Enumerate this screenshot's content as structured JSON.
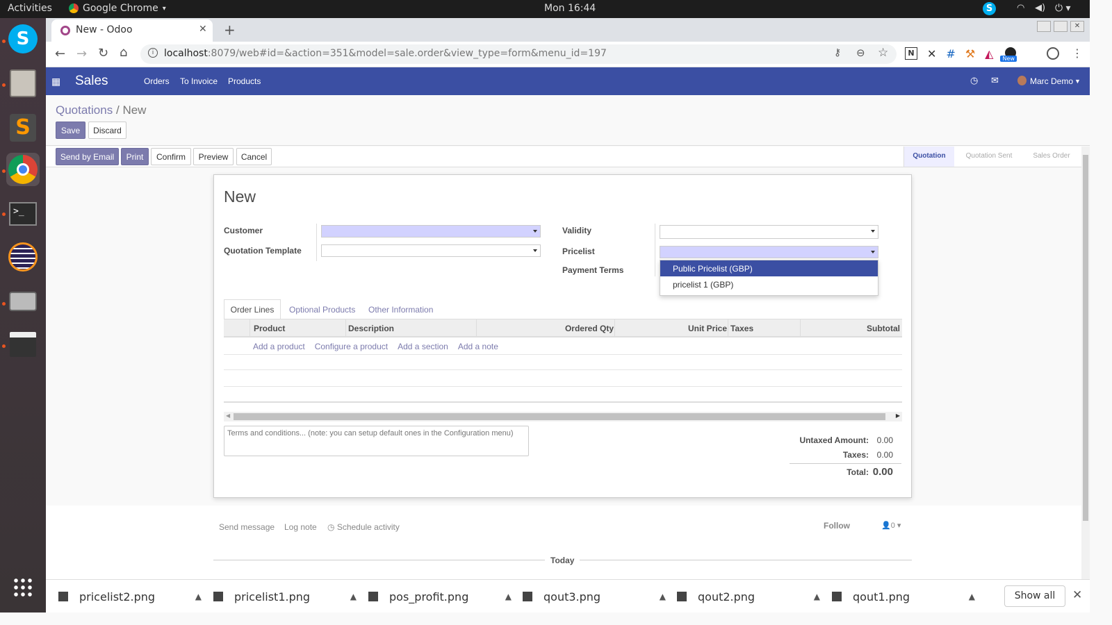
{
  "os": {
    "activities": "Activities",
    "app_menu": "Google Chrome",
    "clock": "Mon 16:44"
  },
  "browser": {
    "tab_title": "New - Odoo",
    "url_host": "localhost",
    "url_rest": ":8079/web#id=&action=351&model=sale.order&view_type=form&menu_id=197",
    "new_badge": "New"
  },
  "odoo_nav": {
    "app": "Sales",
    "menus": [
      "Orders",
      "To Invoice",
      "Products"
    ],
    "user": "Marc Demo"
  },
  "breadcrumb": {
    "parent": "Quotations",
    "sep": "/",
    "current": "New"
  },
  "control": {
    "save": "Save",
    "discard": "Discard"
  },
  "header_buttons": [
    "Send by Email",
    "Print",
    "Confirm",
    "Preview",
    "Cancel"
  ],
  "status_steps": [
    "Quotation",
    "Quotation Sent",
    "Sales Order"
  ],
  "form": {
    "title": "New",
    "customer_label": "Customer",
    "template_label": "Quotation Template",
    "validity_label": "Validity",
    "pricelist_label": "Pricelist",
    "payment_label": "Payment Terms",
    "pricelist_options": [
      "Public Pricelist (GBP)",
      "pricelist 1 (GBP)"
    ],
    "tabs": [
      "Order Lines",
      "Optional Products",
      "Other Information"
    ],
    "columns": [
      "Product",
      "Description",
      "Ordered Qty",
      "Unit Price",
      "Taxes",
      "Subtotal"
    ],
    "add_links": [
      "Add a product",
      "Configure a product",
      "Add a section",
      "Add a note"
    ],
    "terms_placeholder": "Terms and conditions... (note: you can setup default ones in the Configuration menu)",
    "untaxed_label": "Untaxed Amount:",
    "untaxed": "0.00",
    "taxes_label": "Taxes:",
    "taxes": "0.00",
    "total_label": "Total:",
    "total": "0.00"
  },
  "chatter": {
    "send": "Send message",
    "log": "Log note",
    "schedule": "Schedule activity",
    "follow": "Follow",
    "followers": "0",
    "today": "Today"
  },
  "downloads": {
    "files": [
      "pricelist2.png",
      "pricelist1.png",
      "pos_profit.png",
      "qout3.png",
      "qout2.png",
      "qout1.png"
    ],
    "show_all": "Show all"
  }
}
